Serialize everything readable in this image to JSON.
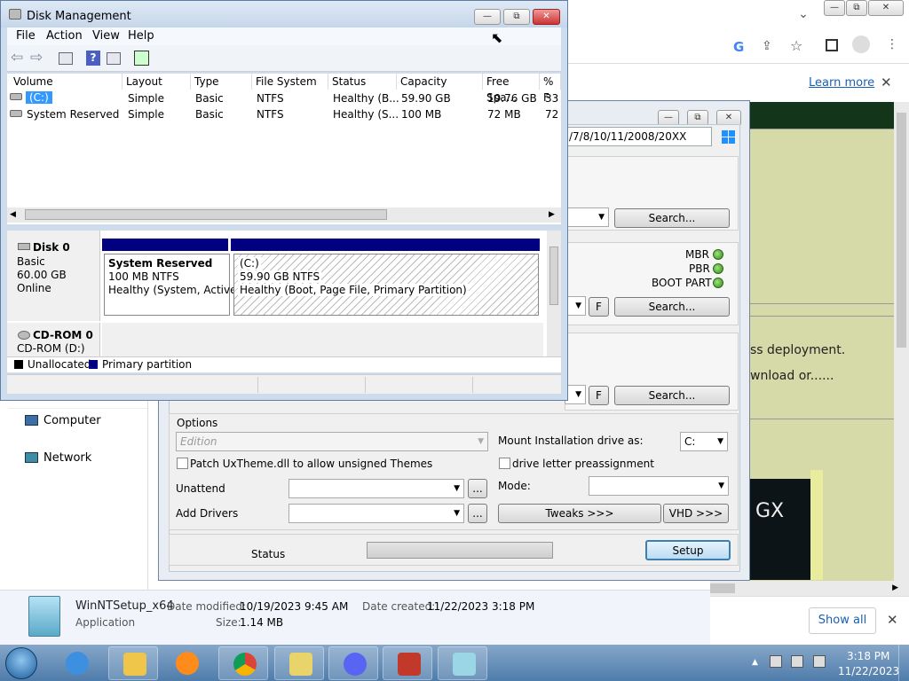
{
  "chrome": {
    "learn_more": "Learn more",
    "min_glyph": "▭",
    "max_glyph": "⧉",
    "close_glyph": "✕",
    "chevron": "⌄",
    "close_x": "✕",
    "show_all": "Show all"
  },
  "web": {
    "line1": "ss deployment.",
    "line2": "wnload or......",
    "gx": "GX"
  },
  "winntsetup": {
    "path_value": "/7/8/10/11/2008/20XX",
    "search1": "Search...",
    "search2": "Search...",
    "search3": "Search...",
    "f_label": "F",
    "f_label2": "F",
    "mbr": "MBR",
    "pbr": "PBR",
    "boot_part": "BOOT PART",
    "options_label": "Options",
    "edition_placeholder": "Edition",
    "patch_label": "Patch UxTheme.dll to allow unsigned Themes",
    "mount_label": "Mount Installation drive as:",
    "mount_value": "C:",
    "drive_letter_label": "drive letter preassignment",
    "unattend_label": "Unattend",
    "mode_label": "Mode:",
    "add_drivers_label": "Add Drivers",
    "tweaks_label": "Tweaks >>>",
    "vhd_label": "VHD >>>",
    "ellipsis": "...",
    "status_label": "Status",
    "setup_label": "Setup",
    "progress": 0
  },
  "explorer": {
    "computer": "Computer",
    "network": "Network",
    "file_name": "WinNTSetup_x64",
    "modified_label": "Date modified:",
    "modified_value": "10/19/2023 9:45 AM",
    "created_label": "Date created:",
    "created_value": "11/22/2023 3:18 PM",
    "type": "Application",
    "size_label": "Size:",
    "size_value": "1.14 MB"
  },
  "diskmgmt": {
    "title": "Disk Management",
    "menu": [
      "File",
      "Action",
      "View",
      "Help"
    ],
    "columns": [
      "Volume",
      "Layout",
      "Type",
      "File System",
      "Status",
      "Capacity",
      "Free Spa...",
      "% F"
    ],
    "rows": [
      {
        "volume": "(C:)",
        "layout": "Simple",
        "type": "Basic",
        "fs": "NTFS",
        "status": "Healthy (B...",
        "capacity": "59.90 GB",
        "free": "19.76 GB",
        "pct": "33"
      },
      {
        "volume": "System Reserved",
        "layout": "Simple",
        "type": "Basic",
        "fs": "NTFS",
        "status": "Healthy (S...",
        "capacity": "100 MB",
        "free": "72 MB",
        "pct": "72"
      }
    ],
    "disk0": {
      "name": "Disk 0",
      "kind": "Basic",
      "size": "60.00 GB",
      "state": "Online"
    },
    "sysres": {
      "name": "System Reserved",
      "size": "100 MB NTFS",
      "status": "Healthy (System, Active,"
    },
    "cpart": {
      "name": "(C:)",
      "size": "59.90 GB NTFS",
      "status": "Healthy (Boot, Page File, Primary Partition)"
    },
    "cdrom": {
      "name": "CD-ROM 0",
      "drive": "CD-ROM (D:)"
    },
    "legend": {
      "unallocated": "Unallocated",
      "primary": "Primary partition"
    }
  },
  "taskbar": {
    "time": "3:18 PM",
    "date": "11/22/2023"
  }
}
